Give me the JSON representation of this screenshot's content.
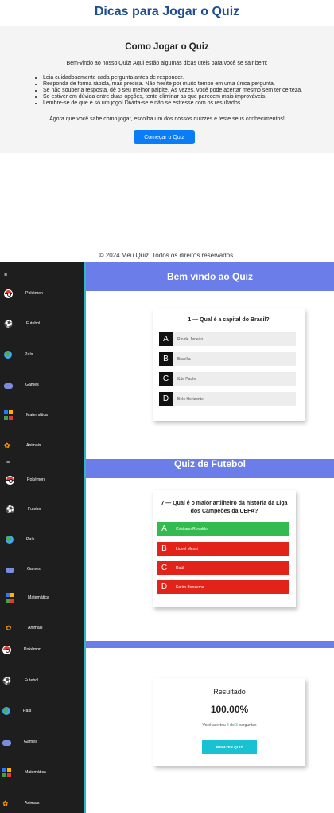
{
  "tips": {
    "page_title": "Dicas para Jogar o Quiz",
    "heading": "Como Jogar o Quiz",
    "intro": "Bem-vindo ao nosso Quiz! Aqui estão algumas dicas úteis para você se sair bem:",
    "items": [
      "Leia cuidadosamente cada pergunta antes de responder.",
      "Responda de forma rápida, mas precisa. Não hesite por muito tempo em uma única pergunta.",
      "Se não souber a resposta, dê o seu melhor palpite. Às vezes, você pode acertar mesmo sem ter certeza.",
      "Se estiver em dúvida entre duas opções, tente eliminar as que parecem mais improváveis.",
      "Lembre-se de que é só um jogo! Divirta-se e não se estresse com os resultados."
    ],
    "outro": "Agora que você sabe como jogar, escolha um dos nossos quizzes e teste seus conhecimentos!",
    "start_button": "Começar o Quiz",
    "footer": "© 2024 Meu Quiz. Todos os direitos reservados."
  },
  "sidebar": {
    "menu_icon": "≡",
    "items": [
      {
        "label": "Pokémon",
        "icon": "pokeball-icon"
      },
      {
        "label": "Futebol",
        "icon": "football-player-icon"
      },
      {
        "label": "País",
        "icon": "globe-icon"
      },
      {
        "label": "Games",
        "icon": "gamepad-icon"
      },
      {
        "label": "Matemática",
        "icon": "math-symbols-icon"
      },
      {
        "label": "Animais",
        "icon": "paw-icon"
      }
    ]
  },
  "quiz1": {
    "banner": "Bem vindo ao Quiz",
    "question": "1 — Qual é a capital do Brasil?",
    "options": [
      {
        "letter": "A",
        "text": "Rio de Janeiro"
      },
      {
        "letter": "B",
        "text": "Brasília"
      },
      {
        "letter": "C",
        "text": "São Paulo"
      },
      {
        "letter": "D",
        "text": "Belo Horizonte"
      }
    ]
  },
  "quiz2": {
    "banner": "Quiz de Futebol",
    "question_line1": "7 — Qual é o maior artilheiro da história da Liga",
    "question_line2": "dos Campeões da UEFA?",
    "options": [
      {
        "letter": "A",
        "text": "Cristiano Ronaldo",
        "state": "correct"
      },
      {
        "letter": "B",
        "text": "Lionel Messi",
        "state": "wrong"
      },
      {
        "letter": "C",
        "text": "Raúl",
        "state": "wrong"
      },
      {
        "letter": "D",
        "text": "Karim Benzema",
        "state": "wrong"
      }
    ]
  },
  "result": {
    "title": "Resultado",
    "score": "100.00%",
    "line_pre": "Você acertou ",
    "correct": "3",
    "line_mid": " de ",
    "total": "3",
    "line_post": " perguntas",
    "redo_button": "REFAZER QUIZ"
  },
  "colors": {
    "banner": "#6a7de8",
    "correct": "#33bb50",
    "wrong": "#e2231a",
    "accent": "#18c2d2",
    "start_button": "#0a7cf5"
  }
}
